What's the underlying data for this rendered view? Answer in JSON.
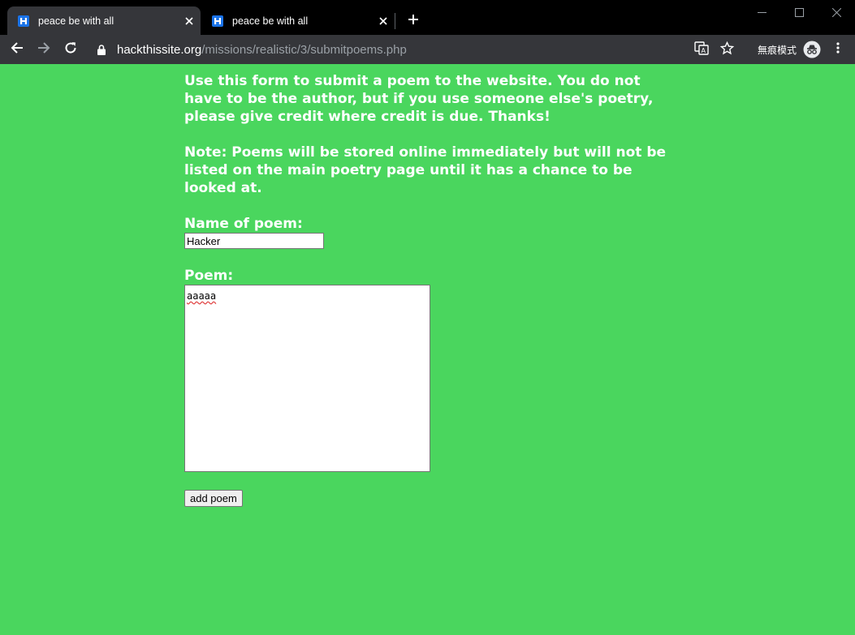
{
  "browser": {
    "tabs": [
      {
        "title": "peace be with all",
        "active": true
      },
      {
        "title": "peace be with all",
        "active": false
      }
    ],
    "url": {
      "host": "hackthissite.org",
      "path": "/missions/realistic/3/submitpoems.php"
    },
    "incognito_label": "無痕模式",
    "icons": {
      "favicon": "hts-logo-icon",
      "close": "close-icon",
      "new_tab": "plus-icon",
      "back": "back-arrow-icon",
      "forward": "forward-arrow-icon",
      "reload": "reload-icon",
      "lock": "lock-icon",
      "translate": "translate-icon",
      "bookmark": "star-icon",
      "incognito": "incognito-icon",
      "menu": "kebab-menu-icon"
    }
  },
  "page": {
    "background_color": "#4ad65e",
    "intro": "Use this form to submit a poem to the website. You do not have to be the author, but if you use someone else's poetry, please give credit where credit is due. Thanks!",
    "note": "Note: Poems will be stored online immediately but will not be listed on the main poetry page until it has a chance to be looked at.",
    "name_label": "Name of poem:",
    "name_value": "Hacker",
    "poem_label": "Poem:",
    "poem_value": "aaaaa",
    "submit_label": "add poem"
  }
}
